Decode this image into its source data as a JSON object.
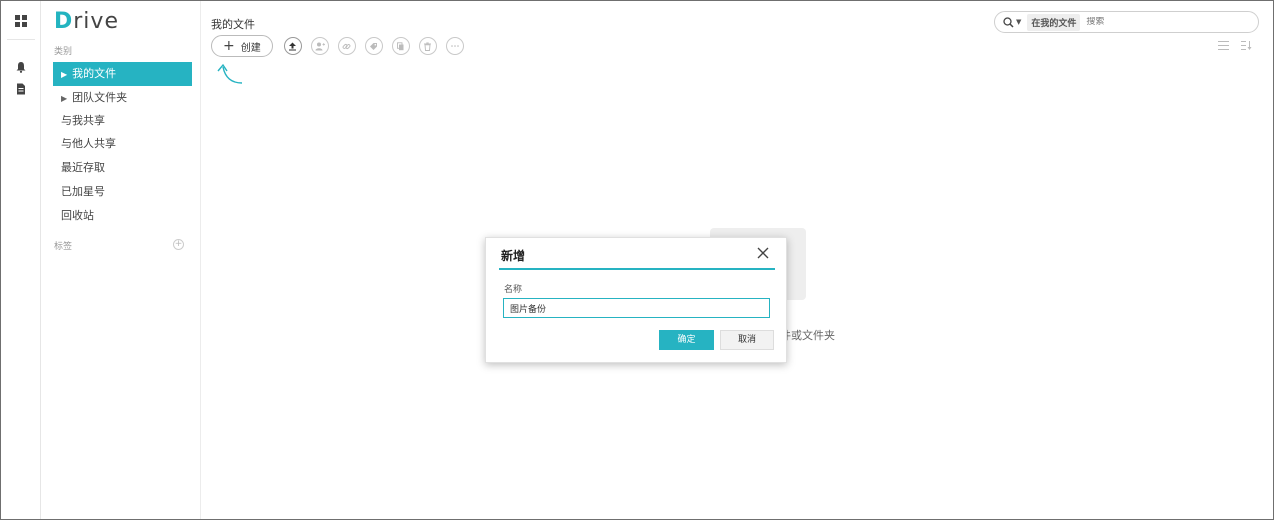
{
  "logo": {
    "first_letter": "D",
    "rest": "rive"
  },
  "sidebar": {
    "category_label": "类别",
    "items": [
      {
        "label": "我的文件",
        "expandable": true,
        "active": true
      },
      {
        "label": "团队文件夹",
        "expandable": true,
        "active": false
      },
      {
        "label": "与我共享"
      },
      {
        "label": "与他人共享"
      },
      {
        "label": "最近存取"
      },
      {
        "label": "已加星号"
      },
      {
        "label": "回收站"
      }
    ],
    "tags_label": "标签"
  },
  "main": {
    "page_title": "我的文件",
    "create_label": "创建",
    "empty_text": "件或文件夹"
  },
  "search": {
    "scope": "在我的文件",
    "placeholder": "搜索"
  },
  "modal": {
    "title": "新增",
    "field_label": "名称",
    "field_value": "图片备份",
    "ok_label": "确定",
    "cancel_label": "取消"
  },
  "colors": {
    "accent": "#26b3c2"
  }
}
